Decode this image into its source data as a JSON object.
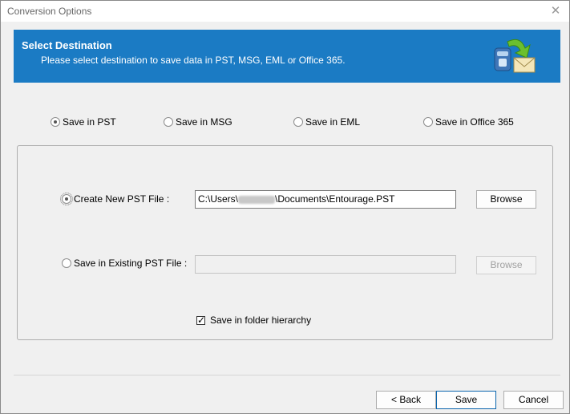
{
  "window": {
    "title": "Conversion Options",
    "close_glyph": "✕"
  },
  "banner": {
    "title": "Select Destination",
    "subtitle": "Please select destination to save data in PST, MSG, EML or Office 365.",
    "icon": "mail-conversion-icon"
  },
  "save_options": [
    {
      "label": "Save in PST",
      "selected": true
    },
    {
      "label": "Save in MSG",
      "selected": false
    },
    {
      "label": "Save in EML",
      "selected": false
    },
    {
      "label": "Save in Office 365",
      "selected": false
    }
  ],
  "pst": {
    "create_new_label": "Create New PST File :",
    "create_new_selected": true,
    "new_path_prefix": "C:\\Users\\",
    "new_path_suffix": "\\Documents\\Entourage.PST",
    "browse_label": "Browse",
    "existing_label": "Save in Existing PST File :",
    "existing_selected": false,
    "existing_path": "",
    "browse_existing_label": "Browse",
    "folder_hierarchy_label": "Save in folder hierarchy",
    "folder_hierarchy_checked": true
  },
  "footer": {
    "back_label": "< Back",
    "save_label": "Save",
    "cancel_label": "Cancel"
  },
  "colors": {
    "banner": "#1b7bc4",
    "window_bg": "#f0f0f0",
    "default_button_border": "#0a64ad"
  }
}
